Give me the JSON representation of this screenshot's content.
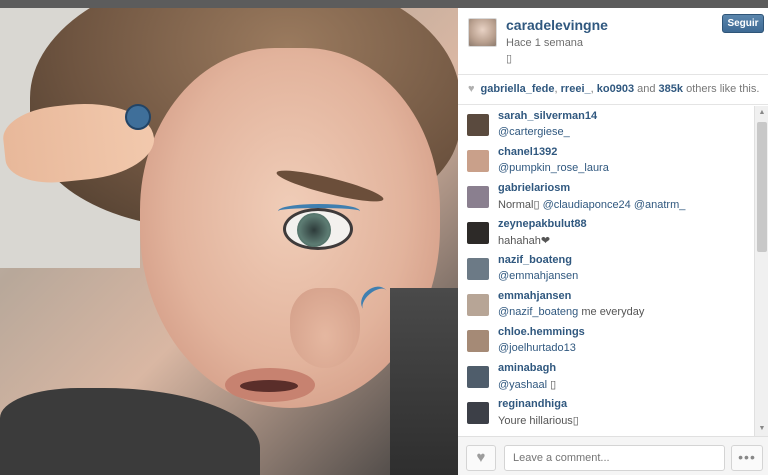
{
  "post": {
    "username": "caradelevingne",
    "posted": "Hace 1 semana",
    "caption": "▯",
    "follow_label": "Seguir"
  },
  "likes": {
    "heart_icon": "heart-icon",
    "user1": "gabriella_fede",
    "sep1": ", ",
    "user2": "rreei_",
    "sep2": ", ",
    "user3": "ko0903",
    "and": " and ",
    "count": "385k",
    "rest": " others like this."
  },
  "comments": [
    {
      "user": "sarah_silverman14",
      "mention": "@cartergiese_",
      "text": "",
      "avatar_color": "#5a4a3e"
    },
    {
      "user": "chanel1392",
      "mention": "@pumpkin_rose_laura",
      "text": "",
      "avatar_color": "#c9a08a"
    },
    {
      "user": "gabrielariosm",
      "pre": "Normal▯ ",
      "mention": "@claudiaponce24 @anatrm_",
      "text": "",
      "avatar_color": "#8a7f8f"
    },
    {
      "user": "zeynepakbulut88",
      "pre": "hahahah❤",
      "mention": "",
      "text": "",
      "avatar_color": "#2d2a28"
    },
    {
      "user": "nazif_boateng",
      "mention": "@emmahjansen",
      "text": "",
      "avatar_color": "#6c7a86"
    },
    {
      "user": "emmahjansen",
      "mention": "@nazif_boateng",
      "text": " me everyday",
      "avatar_color": "#b7a596"
    },
    {
      "user": "chloe.hemmings",
      "mention": "@joelhurtado13",
      "text": "",
      "avatar_color": "#a58a76"
    },
    {
      "user": "aminabagh",
      "mention": "@yashaal",
      "text": " ▯",
      "avatar_color": "#4f5d6b"
    },
    {
      "user": "reginandhiga",
      "pre": "Youre hillarious▯",
      "mention": "",
      "text": "",
      "avatar_color": "#3c3f47"
    }
  ],
  "footer": {
    "comment_placeholder": "Leave a comment...",
    "like_icon": "heart-icon",
    "more_icon": "ellipsis-icon",
    "more_label": "•••",
    "like_label": "♥"
  },
  "scroll": {
    "up": "▲",
    "down": "▼"
  }
}
